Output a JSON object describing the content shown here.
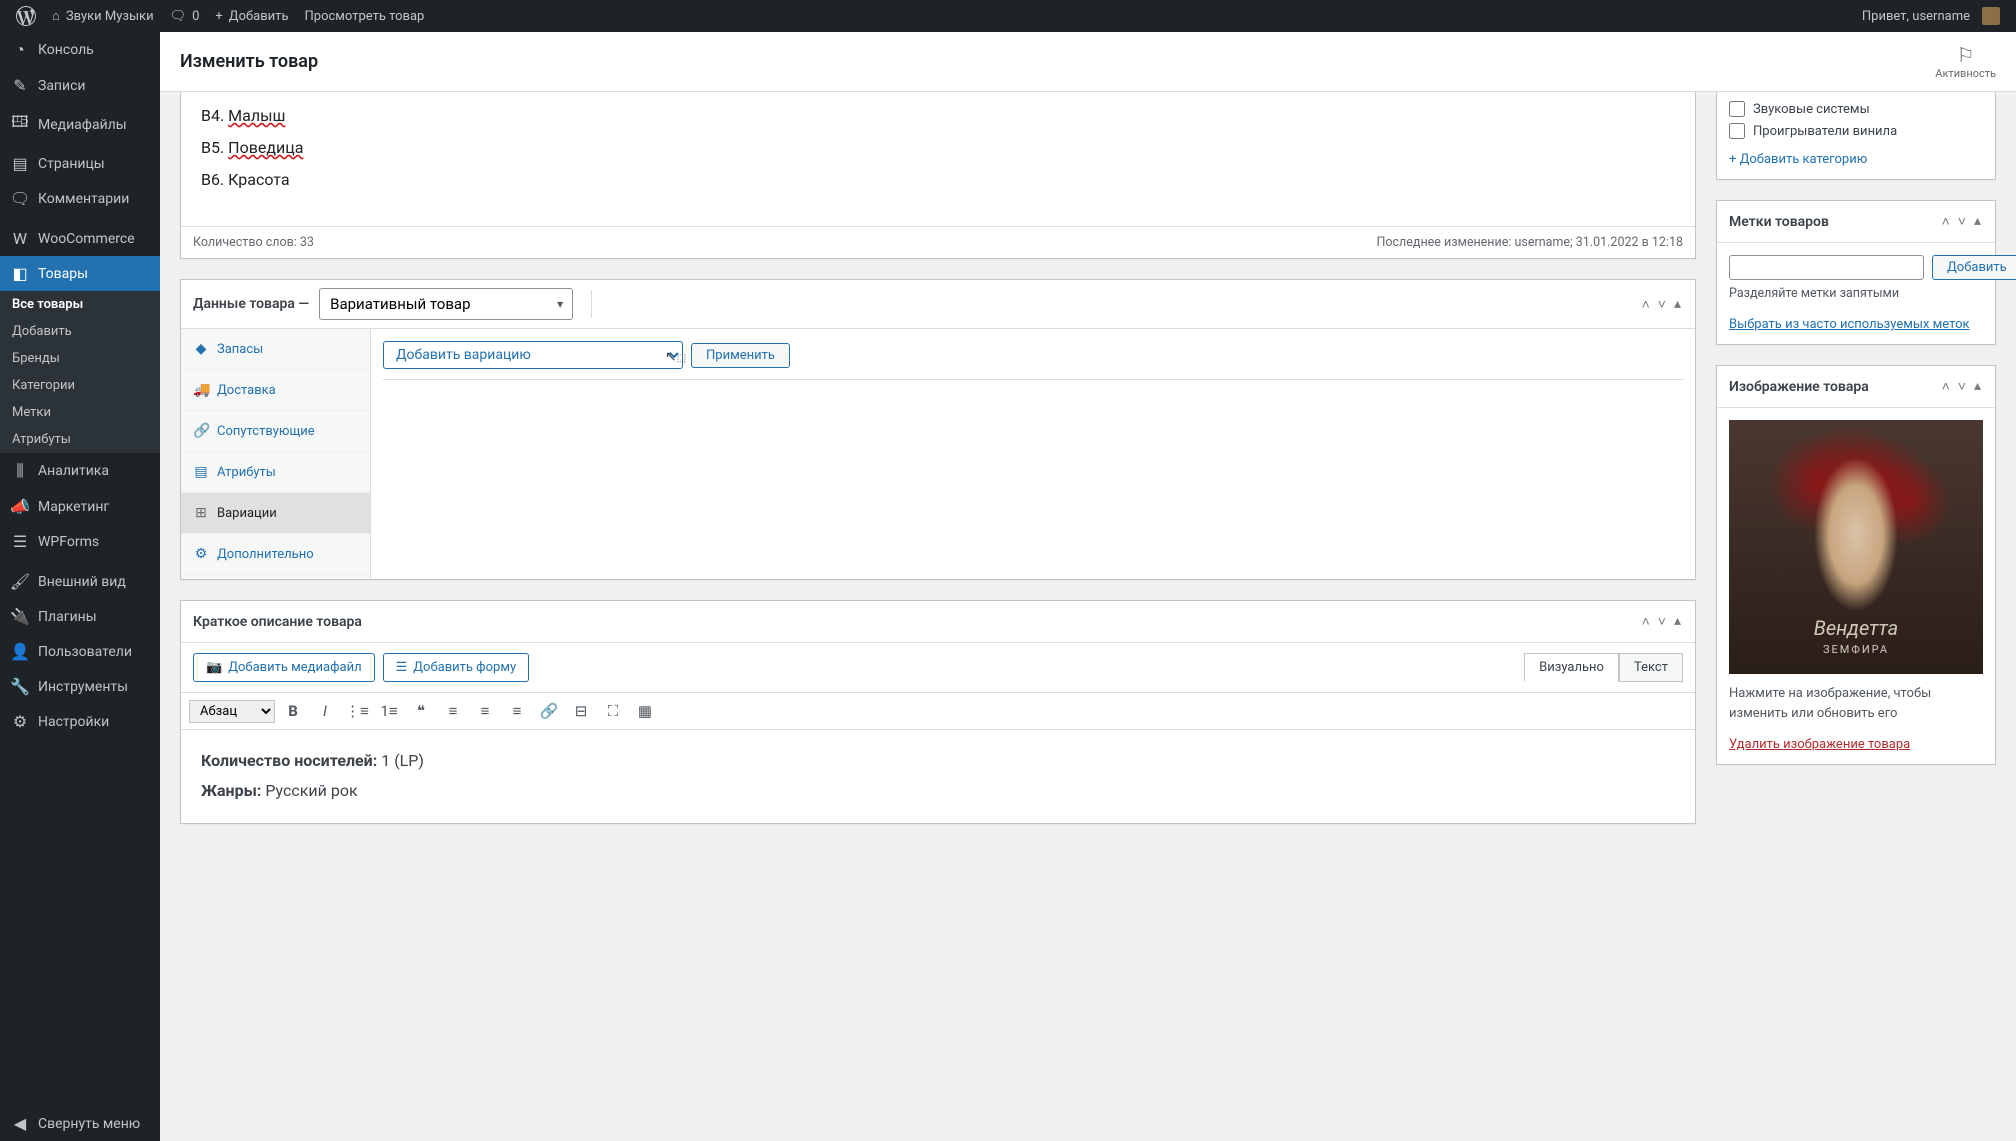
{
  "toolbar": {
    "site_name": "Звуки Музыки",
    "comments_count": "0",
    "add_new": "Добавить",
    "view_product": "Просмотреть товар",
    "greeting": "Привет, username"
  },
  "sidebar": {
    "items": [
      {
        "icon": "◔",
        "label": "Консоль"
      },
      {
        "icon": "✎",
        "label": "Записи"
      },
      {
        "icon": "🖽",
        "label": "Медиафайлы"
      },
      {
        "icon": "▤",
        "label": "Страницы"
      },
      {
        "icon": "🗨",
        "label": "Комментарии"
      },
      {
        "icon": "W",
        "label": "WooCommerce"
      },
      {
        "icon": "◧",
        "label": "Товары",
        "current": true
      },
      {
        "icon": "⫼",
        "label": "Аналитика"
      },
      {
        "icon": "📣",
        "label": "Маркетинг"
      },
      {
        "icon": "☰",
        "label": "WPForms"
      },
      {
        "icon": "🖌",
        "label": "Внешний вид"
      },
      {
        "icon": "🔌",
        "label": "Плагины"
      },
      {
        "icon": "👤",
        "label": "Пользователи"
      },
      {
        "icon": "🔧",
        "label": "Инструменты"
      },
      {
        "icon": "⚙",
        "label": "Настройки"
      }
    ],
    "submenu": [
      {
        "label": "Все товары",
        "active": true
      },
      {
        "label": "Добавить"
      },
      {
        "label": "Бренды"
      },
      {
        "label": "Категории"
      },
      {
        "label": "Метки"
      },
      {
        "label": "Атрибуты"
      }
    ],
    "collapse": "Свернуть меню"
  },
  "page": {
    "title": "Изменить товар",
    "activity": "Активность"
  },
  "editor": {
    "lines": [
      {
        "prefix": "В4. ",
        "word": "Малыш",
        "underline": true
      },
      {
        "prefix": "В5. ",
        "word": "Поведица",
        "underline": true
      },
      {
        "prefix": "В6. ",
        "word": "Красота",
        "underline": false
      }
    ],
    "word_count_label": "Количество слов: 33",
    "last_modified": "Последнее изменение: username; 31.01.2022 в 12:18"
  },
  "product_data": {
    "title": "Данные товара —",
    "type_selected": "Вариативный товар",
    "tabs": [
      {
        "icon": "◆",
        "label": "Запасы"
      },
      {
        "icon": "🚚",
        "label": "Доставка"
      },
      {
        "icon": "🔗",
        "label": "Сопутствующие"
      },
      {
        "icon": "▤",
        "label": "Атрибуты"
      },
      {
        "icon": "⊞",
        "label": "Вариации",
        "active": true
      },
      {
        "icon": "⚙",
        "label": "Дополнительно"
      }
    ],
    "variation_action": "Добавить вариацию",
    "apply_label": "Применить"
  },
  "short_desc": {
    "title": "Краткое описание товара",
    "add_media": "Добавить медиафайл",
    "add_form": "Добавить форму",
    "tab_visual": "Визуально",
    "tab_text": "Текст",
    "paragraph_label": "Абзац",
    "line1_label": "Количество носителей:",
    "line1_value": " 1 (LP)",
    "line2_label": "Жанры:",
    "line2_value": " Русский рок"
  },
  "categories_box": {
    "items": [
      {
        "label": "Звуковые системы"
      },
      {
        "label": "Проигрыватели винила"
      }
    ],
    "add_link": "+ Добавить категорию"
  },
  "tags_box": {
    "title": "Метки товаров",
    "add_button": "Добавить",
    "note": "Разделяйте метки запятыми",
    "popular_link": "Выбрать из часто используемых меток"
  },
  "image_box": {
    "title": "Изображение товара",
    "album_title": "Вендетта",
    "album_artist": "ЗЕМФИРА",
    "note": "Нажмите на изображение, чтобы изменить или обновить его",
    "remove_link": "Удалить изображение товара"
  }
}
